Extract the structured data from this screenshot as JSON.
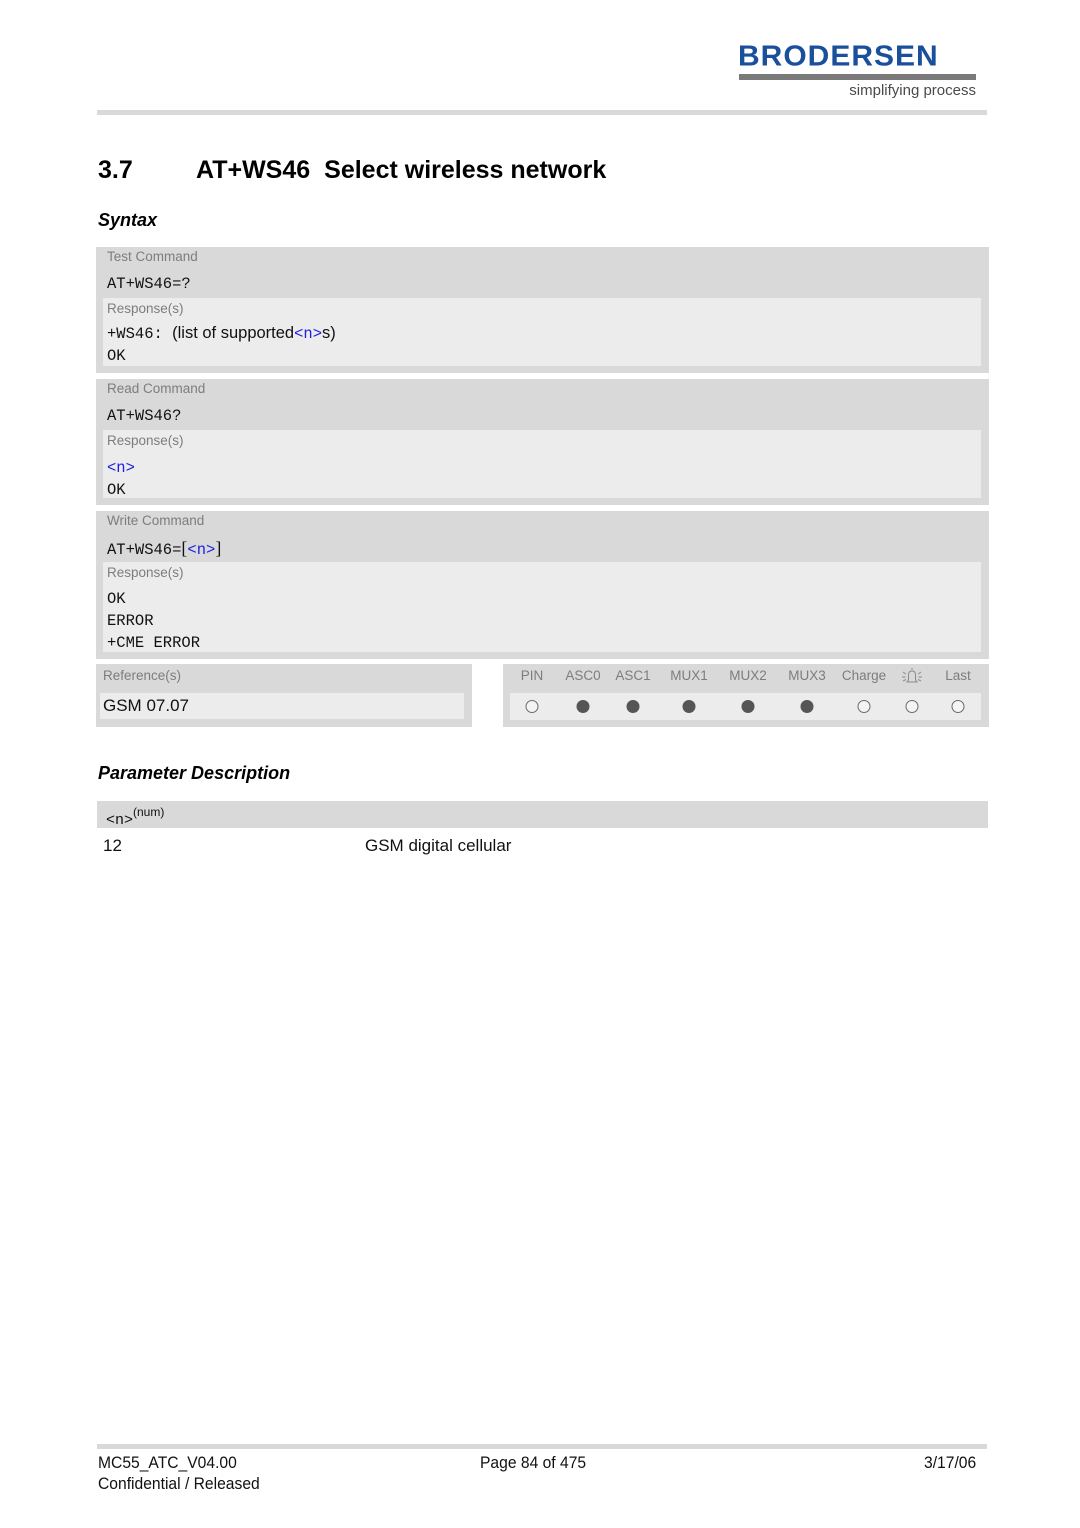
{
  "header": {
    "logo_text": "BRODERSEN",
    "logo_tagline": "simplifying process",
    "brand_color": "#1a4f9c"
  },
  "section": {
    "number": "3.7",
    "command": "AT+WS46",
    "title": "Select wireless network"
  },
  "syntax_heading": "Syntax",
  "commands": [
    {
      "label": "Test Command",
      "syntax": "AT+WS46=?",
      "responses_label": "Response(s)",
      "response": {
        "prefix": "+WS46: ",
        "text_before": "(list of supported",
        "param": "<n>",
        "text_after": "s)",
        "ok": "OK"
      }
    },
    {
      "label": "Read Command",
      "syntax": "AT+WS46?",
      "responses_label": "Response(s)",
      "response": {
        "param": "<n>",
        "ok": "OK"
      }
    },
    {
      "label": "Write Command",
      "syntax_prefix": "AT+WS46=",
      "bracket_open": "[",
      "param": "<n>",
      "bracket_close": "]",
      "responses_label": "Response(s)",
      "response_lines": [
        "OK",
        "ERROR",
        "+CME ERROR"
      ]
    }
  ],
  "references": {
    "label": "Reference(s)",
    "value": "GSM 07.07"
  },
  "applicability": {
    "columns": [
      "PIN",
      "ASC0",
      "ASC1",
      "MUX1",
      "MUX2",
      "MUX3",
      "Charge",
      "alarm-bell-icon",
      "Last"
    ],
    "values": [
      false,
      true,
      true,
      true,
      true,
      true,
      false,
      false,
      false
    ],
    "filled_color": "#555555"
  },
  "parameter_heading": "Parameter Description",
  "parameters": [
    {
      "name": "<n>",
      "type": "(num)",
      "values": [
        {
          "value": "12",
          "description": "GSM digital cellular"
        }
      ]
    }
  ],
  "footer": {
    "doc_id": "MC55_ATC_V04.00",
    "page": "Page 84 of 475",
    "date": "3/17/06",
    "classification": "Confidential / Released"
  }
}
